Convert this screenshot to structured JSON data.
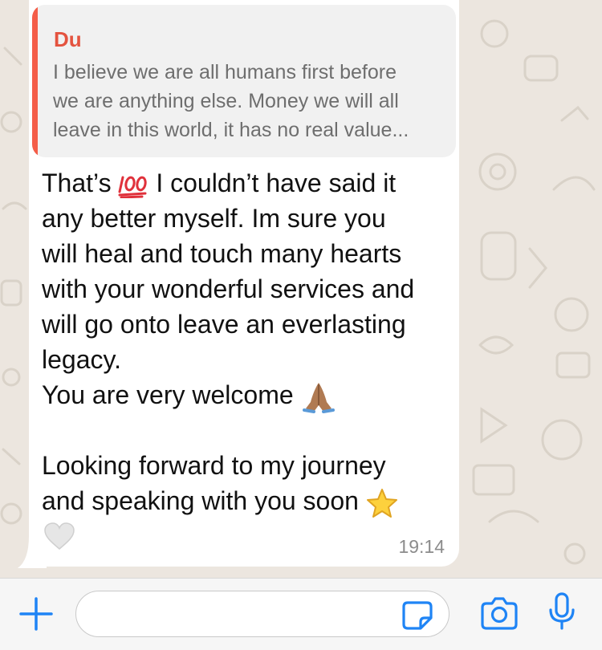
{
  "message": {
    "quoted": {
      "author": "Du",
      "text_lines": [
        "I believe we are all humans first before",
        "we are anything else. Money we will all",
        "leave in this world, it has no real value..."
      ]
    },
    "lines": [
      {
        "pre": "That’s ",
        "emoji": "hundred-points-icon",
        "post": " I couldn’t have said it"
      },
      {
        "text": "any better myself.  Im sure you"
      },
      {
        "text": "will heal and touch many hearts"
      },
      {
        "text": "with your wonderful services and"
      },
      {
        "text": "will go onto leave an everlasting"
      },
      {
        "text": "legacy."
      },
      {
        "pre": "You are very welcome ",
        "emoji": "folded-hands-icon"
      },
      {
        "text": ""
      },
      {
        "text": "Looking forward to my journey"
      },
      {
        "pre": "and speaking with you soon ",
        "emoji": "star-icon"
      }
    ],
    "reaction_icon": "white-heart-icon",
    "time": "19:14"
  },
  "input": {
    "placeholder": ""
  },
  "icons": [
    "plus-icon",
    "sticker-icon",
    "camera-icon",
    "microphone-icon"
  ],
  "colors": {
    "accent": "#1f84f5",
    "quote_bar": "#f45d48",
    "quote_author": "#e4533f",
    "background": "#ece6df"
  }
}
